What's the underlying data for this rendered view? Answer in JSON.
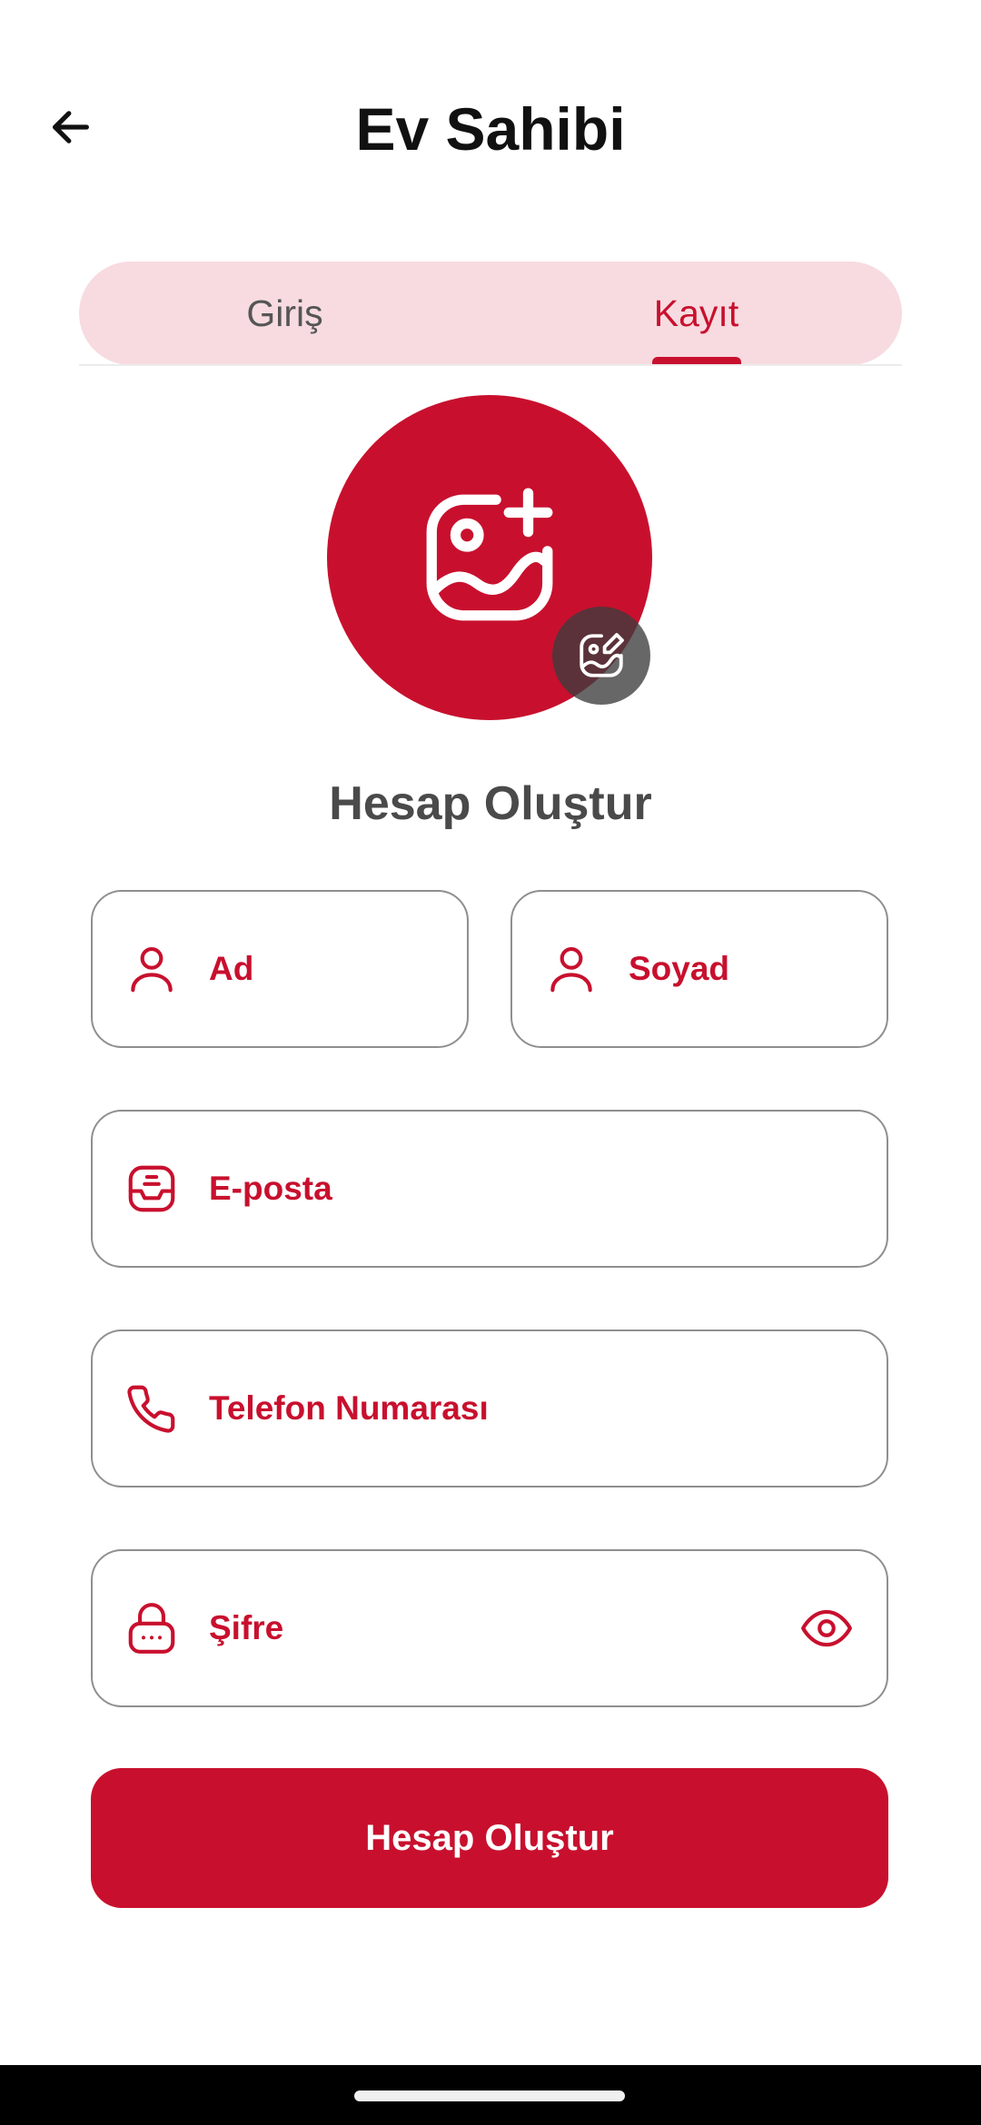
{
  "header": {
    "title": "Ev Sahibi",
    "back_icon": "arrow-left-icon"
  },
  "tabs": [
    {
      "label": "Giriş",
      "active": false
    },
    {
      "label": "Kayıt",
      "active": true
    }
  ],
  "avatar": {
    "icon": "image-add-icon",
    "edit_icon": "image-edit-icon"
  },
  "form": {
    "title": "Hesap Oluştur",
    "fields": {
      "first_name": {
        "placeholder": "Ad",
        "icon": "user-icon"
      },
      "last_name": {
        "placeholder": "Soyad",
        "icon": "user-icon"
      },
      "email": {
        "placeholder": "E-posta",
        "icon": "inbox-icon"
      },
      "phone": {
        "placeholder": "Telefon Numarası",
        "icon": "phone-icon"
      },
      "password": {
        "placeholder": "Şifre",
        "icon": "lock-icon",
        "toggle_icon": "eye-icon"
      }
    },
    "submit_label": "Hesap Oluştur"
  },
  "colors": {
    "accent": "#c8102e",
    "tab_background": "#f7dbe0",
    "field_border": "#8f8f8f"
  }
}
